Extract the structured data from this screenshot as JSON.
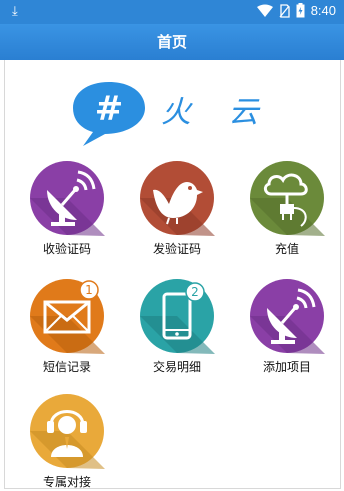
{
  "status_bar": {
    "time": "8:40",
    "icons": [
      "download-icon",
      "wifi-icon",
      "sim-icon",
      "battery-icon"
    ]
  },
  "header": {
    "title": "首页"
  },
  "logo": {
    "glyph": "#",
    "text": "火 云"
  },
  "tiles": [
    {
      "label": "收验证码",
      "icon": "satellite-dish-icon",
      "color": "#8a3fa6"
    },
    {
      "label": "发验证码",
      "icon": "bird-icon",
      "color": "#b24d36"
    },
    {
      "label": "充值",
      "icon": "cloud-plug-icon",
      "color": "#6b8a3a"
    },
    {
      "label": "短信记录",
      "icon": "envelope-icon",
      "color": "#e07a1a",
      "badge": "1"
    },
    {
      "label": "交易明细",
      "icon": "phone-icon",
      "color": "#2aa3a6",
      "badge": "2"
    },
    {
      "label": "添加项目",
      "icon": "satellite-dish-icon",
      "color": "#8a3fa6"
    },
    {
      "label": "专属对接",
      "icon": "headset-person-icon",
      "color": "#e9a93a"
    }
  ]
}
